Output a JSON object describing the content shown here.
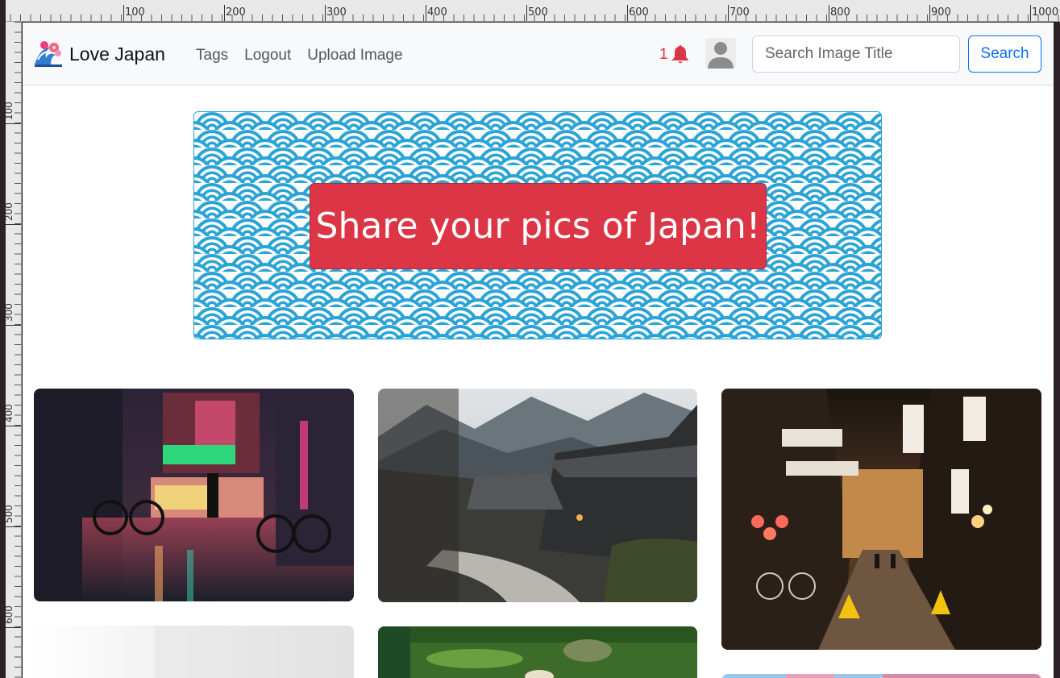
{
  "ruler": {
    "top_labels": [
      "100",
      "200",
      "300",
      "400",
      "500",
      "600",
      "700",
      "800",
      "900",
      "1000"
    ],
    "left_labels": [
      "100",
      "200",
      "300",
      "400",
      "500",
      "600"
    ]
  },
  "navbar": {
    "brand": "Love Japan",
    "links": [
      "Tags",
      "Logout",
      "Upload Image"
    ],
    "notification_count": "1",
    "search_placeholder": "Search Image Title",
    "search_button": "Search"
  },
  "banner": {
    "cta": "Share your pics of Japan!",
    "pattern_color": "#2aa3d6",
    "button_color": "#dc3545"
  },
  "gallery": {
    "images": [
      {
        "icon": "rainy-night-street-photo"
      },
      {
        "icon": "mountain-village-photo"
      },
      {
        "icon": "lantern-alley-photo"
      },
      {
        "icon": "misty-photo"
      },
      {
        "icon": "moss-garden-photo"
      },
      {
        "icon": "cherry-blossom-photo"
      }
    ]
  }
}
